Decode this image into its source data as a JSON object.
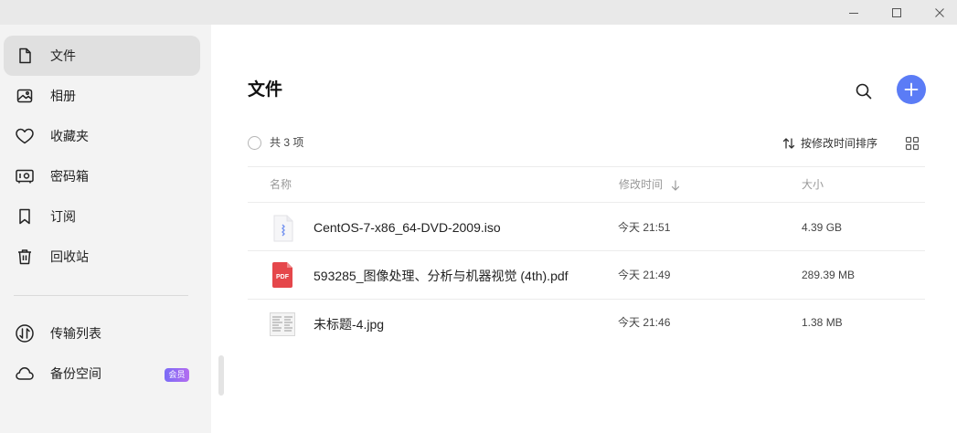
{
  "window": {
    "minimize_icon": "minimize-icon",
    "maximize_icon": "maximize-icon",
    "close_icon": "close-icon"
  },
  "sidebar": {
    "items": [
      {
        "label": "文件",
        "icon": "file-icon",
        "active": true
      },
      {
        "label": "相册",
        "icon": "photo-icon"
      },
      {
        "label": "收藏夹",
        "icon": "heart-icon"
      },
      {
        "label": "密码箱",
        "icon": "safe-icon"
      },
      {
        "label": "订阅",
        "icon": "bookmark-icon"
      },
      {
        "label": "回收站",
        "icon": "trash-icon"
      }
    ],
    "bottom_items": [
      {
        "label": "传输列表",
        "icon": "transfer-icon"
      },
      {
        "label": "备份空间",
        "icon": "cloud-icon",
        "badge": "会员"
      }
    ]
  },
  "main": {
    "title": "文件",
    "count_text": "共 3 项",
    "sort_label": "按修改时间排序",
    "columns": {
      "name": "名称",
      "modified": "修改时间",
      "size": "大小"
    },
    "files": [
      {
        "name": "CentOS-7-x86_64-DVD-2009.iso",
        "modified": "今天 21:51",
        "size": "4.39 GB",
        "type": "archive"
      },
      {
        "name": "593285_图像处理、分析与机器视觉 (4th).pdf",
        "modified": "今天 21:49",
        "size": "289.39 MB",
        "type": "pdf",
        "type_label": "PDF"
      },
      {
        "name": "未标题-4.jpg",
        "modified": "今天 21:46",
        "size": "1.38 MB",
        "type": "image"
      }
    ]
  },
  "colors": {
    "accent": "#5b7cf6",
    "pdf": "#e5474b",
    "vip_badge": "#8f6cf4"
  }
}
